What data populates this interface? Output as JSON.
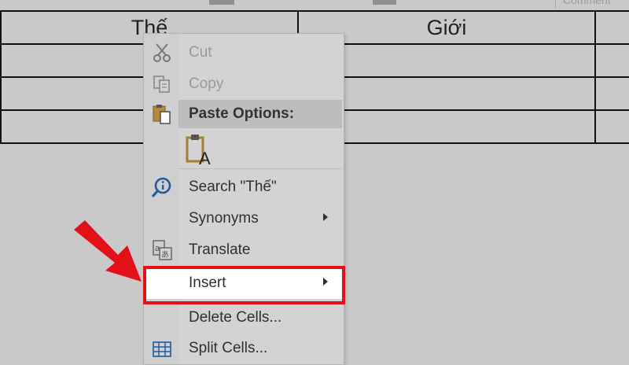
{
  "toolbar": {
    "comment_label": "Comment"
  },
  "table": {
    "rows": [
      [
        "Thế",
        "Giới",
        ""
      ],
      [
        "",
        "",
        ""
      ],
      [
        "",
        "",
        ""
      ],
      [
        "",
        "",
        ""
      ]
    ]
  },
  "context_menu": {
    "cut": {
      "label": "Cut",
      "icon": "scissors-icon",
      "enabled": false
    },
    "copy": {
      "label": "Copy",
      "icon": "copy-icon",
      "enabled": false
    },
    "paste_options": {
      "label": "Paste Options:",
      "icon": "paste-icon",
      "option_icon": "paste-keep-text-only-icon"
    },
    "search": {
      "label": "Search \"Thế\"",
      "icon": "smart-lookup-icon"
    },
    "synonyms": {
      "label": "Synonyms",
      "has_submenu": true
    },
    "translate": {
      "label": "Translate",
      "icon": "translate-icon"
    },
    "insert": {
      "label": "Insert",
      "has_submenu": true,
      "highlighted": true
    },
    "delete_cells": {
      "label": "Delete Cells..."
    },
    "split_cells": {
      "label": "Split Cells...",
      "icon": "split-cells-icon"
    }
  },
  "annotation": {
    "color": "#e3101a",
    "pointer": "red-arrow-icon"
  }
}
